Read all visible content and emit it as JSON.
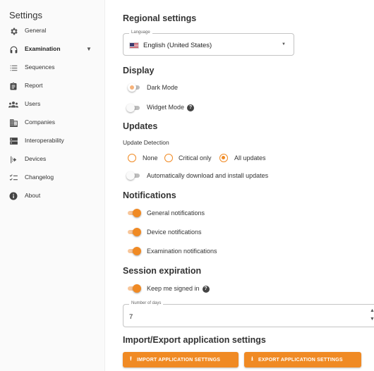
{
  "sidebar": {
    "title": "Settings",
    "items": [
      {
        "label": "General",
        "icon": "gear-icon"
      },
      {
        "label": "Examination",
        "icon": "headphones-icon",
        "active": true
      },
      {
        "label": "Sequences",
        "icon": "list-icon"
      },
      {
        "label": "Report",
        "icon": "clipboard-icon"
      },
      {
        "label": "Users",
        "icon": "users-icon"
      },
      {
        "label": "Companies",
        "icon": "building-icon"
      },
      {
        "label": "Interoperability",
        "icon": "server-icon"
      },
      {
        "label": "Devices",
        "icon": "devices-icon"
      },
      {
        "label": "Changelog",
        "icon": "checklist-icon"
      },
      {
        "label": "About",
        "icon": "info-icon"
      }
    ]
  },
  "regional": {
    "title": "Regional settings",
    "language_label": "Language",
    "language_value": "English (United States)"
  },
  "display": {
    "title": "Display",
    "dark_mode": "Dark Mode",
    "widget_mode": "Widget Mode"
  },
  "updates": {
    "title": "Updates",
    "detection_label": "Update Detection",
    "options": [
      "None",
      "Critical only",
      "All updates"
    ],
    "selected": "All updates",
    "auto_download": "Automatically download and install updates"
  },
  "notifications": {
    "title": "Notifications",
    "general": "General notifications",
    "device": "Device notifications",
    "examination": "Examination notifications"
  },
  "session": {
    "title": "Session expiration",
    "keep_signed_in": "Keep me signed in",
    "days_label": "Number of days",
    "days_value": "7"
  },
  "import_export": {
    "title": "Import/Export application settings",
    "import_label": "IMPORT APPLICATION SETTINGS",
    "export_label": "EXPORT APPLICATION SETTINGS"
  },
  "colors": {
    "accent": "#f08a24",
    "accent_light": "#f8c69a"
  }
}
